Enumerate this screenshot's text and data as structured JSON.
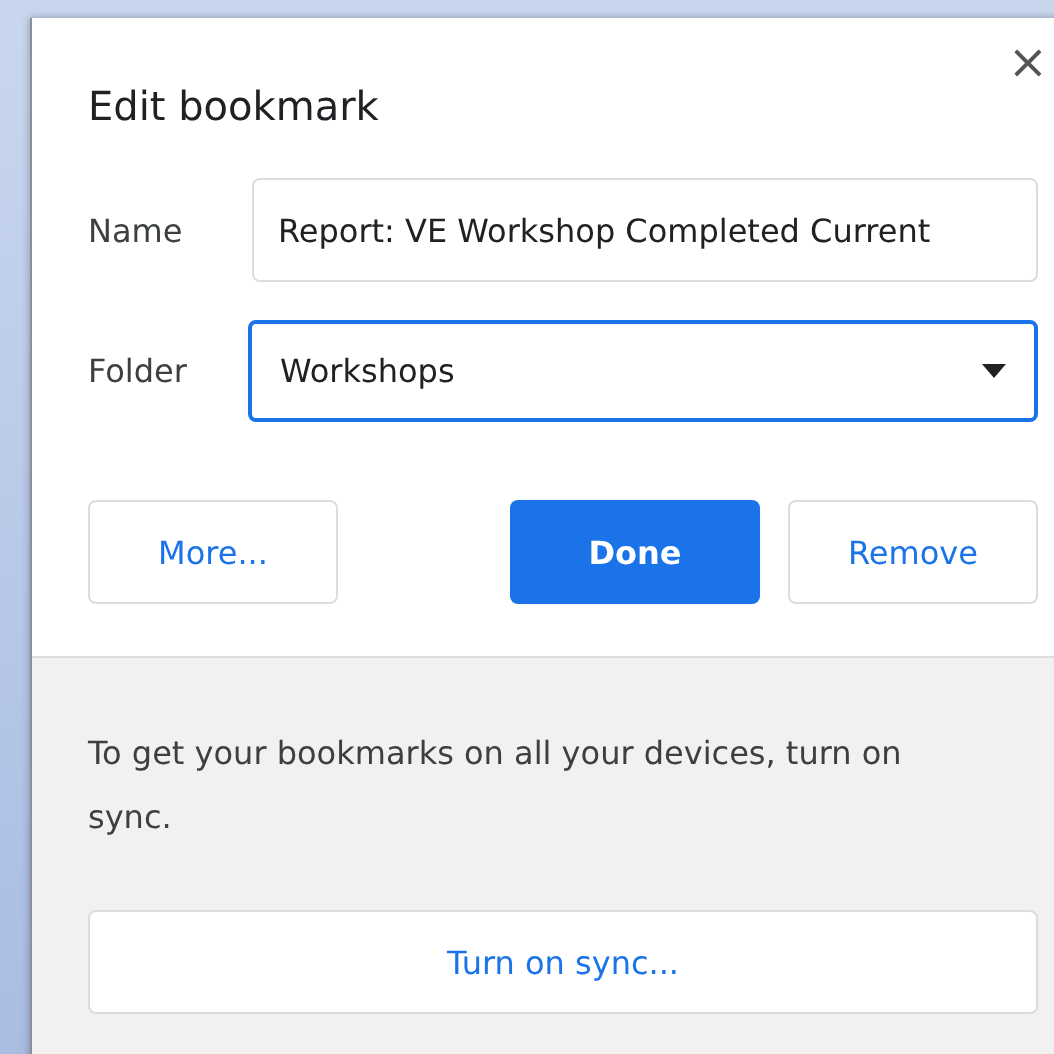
{
  "dialog": {
    "title": "Edit bookmark",
    "close": "×"
  },
  "fields": [
    {
      "kind": "text",
      "label": "Name",
      "value": "Report: VE Workshop Completed Current",
      "focused": false
    },
    {
      "kind": "select",
      "label": "Folder",
      "value": "Workshops",
      "focused": true
    }
  ],
  "buttons": [
    {
      "label": "More...",
      "primary": false
    },
    {
      "label": "Done",
      "primary": true
    },
    {
      "label": "Remove",
      "primary": false
    }
  ],
  "footer": {
    "message": "To get your bookmarks on all your devices, turn on sync.",
    "button": "Turn on sync..."
  }
}
